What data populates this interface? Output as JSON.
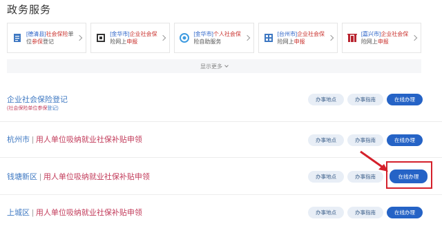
{
  "header": {
    "title": "政务服务"
  },
  "quick_cards": [
    {
      "region": "[德清县]",
      "before": "",
      "hl1": "社会保险",
      "mid": "单",
      "line2a": "位",
      "hl2": "参保",
      "line2b": "登记",
      "icon": "document-icon"
    },
    {
      "region": "[金华市]",
      "before": "",
      "hl1": "企业社会保",
      "mid": "",
      "line2a": "险网上",
      "hl2": "申报",
      "line2b": "",
      "icon": "id-card-icon"
    },
    {
      "region": "[金华市]",
      "before": "",
      "hl1": "个人社会保",
      "mid": "",
      "line2a": "险自助服务",
      "hl2": "",
      "line2b": "",
      "icon": "swirl-icon"
    },
    {
      "region": "[台州市]",
      "before": "",
      "hl1": "企业社会保",
      "mid": "",
      "line2a": "险网上",
      "hl2": "申报",
      "line2b": "",
      "icon": "building-icon"
    },
    {
      "region": "[嘉兴市]",
      "before": "",
      "hl1": "企业社会保",
      "mid": "",
      "line2a": "险网上",
      "hl2": "申报",
      "line2b": "",
      "icon": "gate-icon"
    }
  ],
  "show_more": {
    "label": "显示更多"
  },
  "services": [
    {
      "region": "",
      "name": "企业社会保险登记",
      "sub_prefix": "(",
      "sub_hl": "社会保险单位参保",
      "sub_suffix": "登记)"
    },
    {
      "region": "杭州市",
      "separator": "|",
      "name": "用人单位吸纳就业社保补贴申领"
    },
    {
      "region": "钱塘新区",
      "separator": "|",
      "name": "用人单位吸纳就业社保补贴申领"
    },
    {
      "region": "上城区",
      "separator": "|",
      "name": "用人单位吸纳就业社保补贴申领"
    }
  ],
  "buttons": {
    "location": "办事地点",
    "guide": "办事指南",
    "online": "在线办理"
  },
  "colors": {
    "primary": "#2563c6",
    "light": "#e8eef6",
    "highlight": "#d4202b",
    "accent": "#c23b5a"
  }
}
